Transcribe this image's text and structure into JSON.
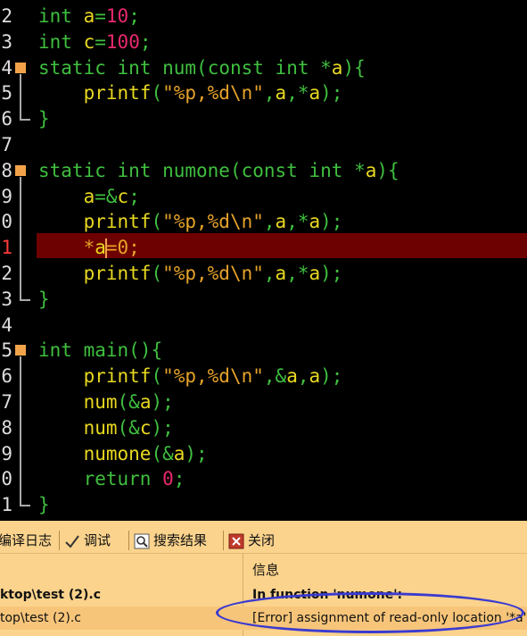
{
  "editor": {
    "lines": [
      {
        "n": "2",
        "html": "<span class=\"kw\">int</span> <span class=\"id\">a</span><span class=\"op\">=</span><span class=\"num\">10</span><span class=\"op\">;</span>"
      },
      {
        "n": "3",
        "html": "<span class=\"kw\">int</span> <span class=\"id\">c</span><span class=\"op\">=</span><span class=\"num\">100</span><span class=\"op\">;</span>"
      },
      {
        "n": "4",
        "fold": true,
        "html": "<span class=\"kw\">static int</span> <span class=\"fn\">num</span><span class=\"op\">(</span><span class=\"kw\">const int</span> <span class=\"op\">*</span><span class=\"id\">a</span><span class=\"op\">){</span>"
      },
      {
        "n": "5",
        "html": "    <span class=\"id\">printf</span><span class=\"op\">(</span><span class=\"str\">\"%p,%d\\n\"</span><span class=\"op\">,</span><span class=\"id\">a</span><span class=\"op\">,*</span><span class=\"id\">a</span><span class=\"op\">);</span>"
      },
      {
        "n": "6",
        "html": "<span class=\"op\">}</span>"
      },
      {
        "n": "7",
        "html": ""
      },
      {
        "n": "8",
        "fold": true,
        "html": "<span class=\"kw\">static int</span> <span class=\"fn\">numone</span><span class=\"op\">(</span><span class=\"kw\">const int</span> <span class=\"op\">*</span><span class=\"id\">a</span><span class=\"op\">){</span>"
      },
      {
        "n": "9",
        "html": "    <span class=\"id\">a</span><span class=\"op\">=&amp;</span><span class=\"id\">c</span><span class=\"op\">;</span>"
      },
      {
        "n": "0",
        "html": "    <span class=\"id\">printf</span><span class=\"op\">(</span><span class=\"str\">\"%p,%d\\n\"</span><span class=\"op\">,</span><span class=\"id\">a</span><span class=\"op\">,*</span><span class=\"id\">a</span><span class=\"op\">);</span>"
      },
      {
        "n": "1",
        "err": true,
        "html": "    <span class=\"str\">*</span><span class=\"id\">a</span><span class=\"cursor\"></span><span class=\"str\">=0;</span>"
      },
      {
        "n": "2",
        "html": "    <span class=\"id\">printf</span><span class=\"op\">(</span><span class=\"str\">\"%p,%d\\n\"</span><span class=\"op\">,</span><span class=\"id\">a</span><span class=\"op\">,*</span><span class=\"id\">a</span><span class=\"op\">);</span>"
      },
      {
        "n": "3",
        "html": "<span class=\"op\">}</span>"
      },
      {
        "n": "4",
        "html": ""
      },
      {
        "n": "5",
        "fold": true,
        "html": "<span class=\"kw\">int</span> <span class=\"fn\">main</span><span class=\"op\">(){</span>"
      },
      {
        "n": "6",
        "html": "    <span class=\"id\">printf</span><span class=\"op\">(</span><span class=\"str\">\"%p,%d\\n\"</span><span class=\"op\">,&amp;</span><span class=\"id\">a</span><span class=\"op\">,</span><span class=\"id\">a</span><span class=\"op\">);</span>"
      },
      {
        "n": "7",
        "html": "    <span class=\"id\">num</span><span class=\"op\">(&amp;</span><span class=\"id\">a</span><span class=\"op\">);</span>"
      },
      {
        "n": "8",
        "html": "    <span class=\"id\">num</span><span class=\"op\">(&amp;</span><span class=\"id\">c</span><span class=\"op\">);</span>"
      },
      {
        "n": "9",
        "html": "    <span class=\"id\">numone</span><span class=\"op\">(&amp;</span><span class=\"id\">a</span><span class=\"op\">);</span>"
      },
      {
        "n": "0",
        "html": "    <span class=\"kw\">return</span> <span class=\"num\">0</span><span class=\"op\">;</span>"
      },
      {
        "n": "1",
        "html": "<span class=\"op\">}</span>"
      }
    ]
  },
  "panel": {
    "tabs": {
      "compile_log": "编译日志",
      "debug": "调试",
      "search_results": "搜索结果",
      "close": "关闭"
    },
    "header_info": "信息",
    "rows": [
      {
        "file": "ktop\\test (2).c",
        "msg": "In function 'numone':"
      },
      {
        "file": "top\\test (2).c",
        "msg": "[Error] assignment of read-only location '*a'"
      }
    ]
  },
  "colors": {
    "error_line": "#6d0000",
    "panel_bg": "#fbd38c",
    "annotation": "#3a3ad0"
  }
}
